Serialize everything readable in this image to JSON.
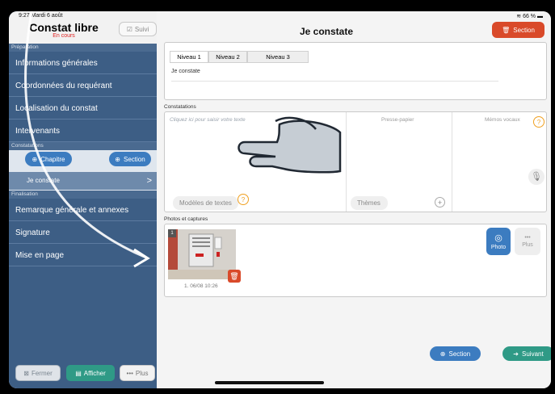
{
  "status_bar": {
    "time": "9:27  Mardi 6 août",
    "battery": "66 %"
  },
  "sidebar": {
    "title": "Constat libre",
    "subtitle": "En cours",
    "suivi_label": "Suivi",
    "section_preparation": "Préparation",
    "items": [
      {
        "label": "Informations générales"
      },
      {
        "label": "Coordonnées du requérant"
      },
      {
        "label": "Localisation du constat"
      },
      {
        "label": "Intervenants"
      }
    ],
    "section_constatations": "Constatations",
    "chapitre_label": "Chapitre",
    "section_label": "Section",
    "active_item": "Je constate",
    "section_finalisation": "Finalisation",
    "final_items": [
      {
        "label": "Remarque générale et annexes"
      },
      {
        "label": "Signature"
      },
      {
        "label": "Mise en page"
      }
    ],
    "fermer_label": "Fermer",
    "afficher_label": "Afficher",
    "plus_label": "Plus"
  },
  "header": {
    "title": "Je constate",
    "section_button": "Section"
  },
  "niveaux": {
    "tabs": [
      "Niveau 1",
      "Niveau 2",
      "Niveau 3"
    ],
    "text": "Je constate"
  },
  "constatations": {
    "label": "Constatations",
    "placeholder": "Cliquez ici pour saisir votre texte",
    "presse_papier": "Presse-papier",
    "memos_vocaux": "Mémos vocaux",
    "modeles_label": "Modèles de textes",
    "themes_label": "Thèmes"
  },
  "photos": {
    "label": "Photos et captures",
    "index": "1",
    "caption": "1.   06/08 10:26",
    "photo_label": "Photo",
    "plus_label": "Plus"
  },
  "footer": {
    "section_label": "Section",
    "suivant_label": "Suivant"
  },
  "colors": {
    "sidebar": "#3d5e85",
    "accent_blue": "#3c7cc0",
    "accent_red": "#d94a2a",
    "accent_green": "#2f9a86"
  }
}
